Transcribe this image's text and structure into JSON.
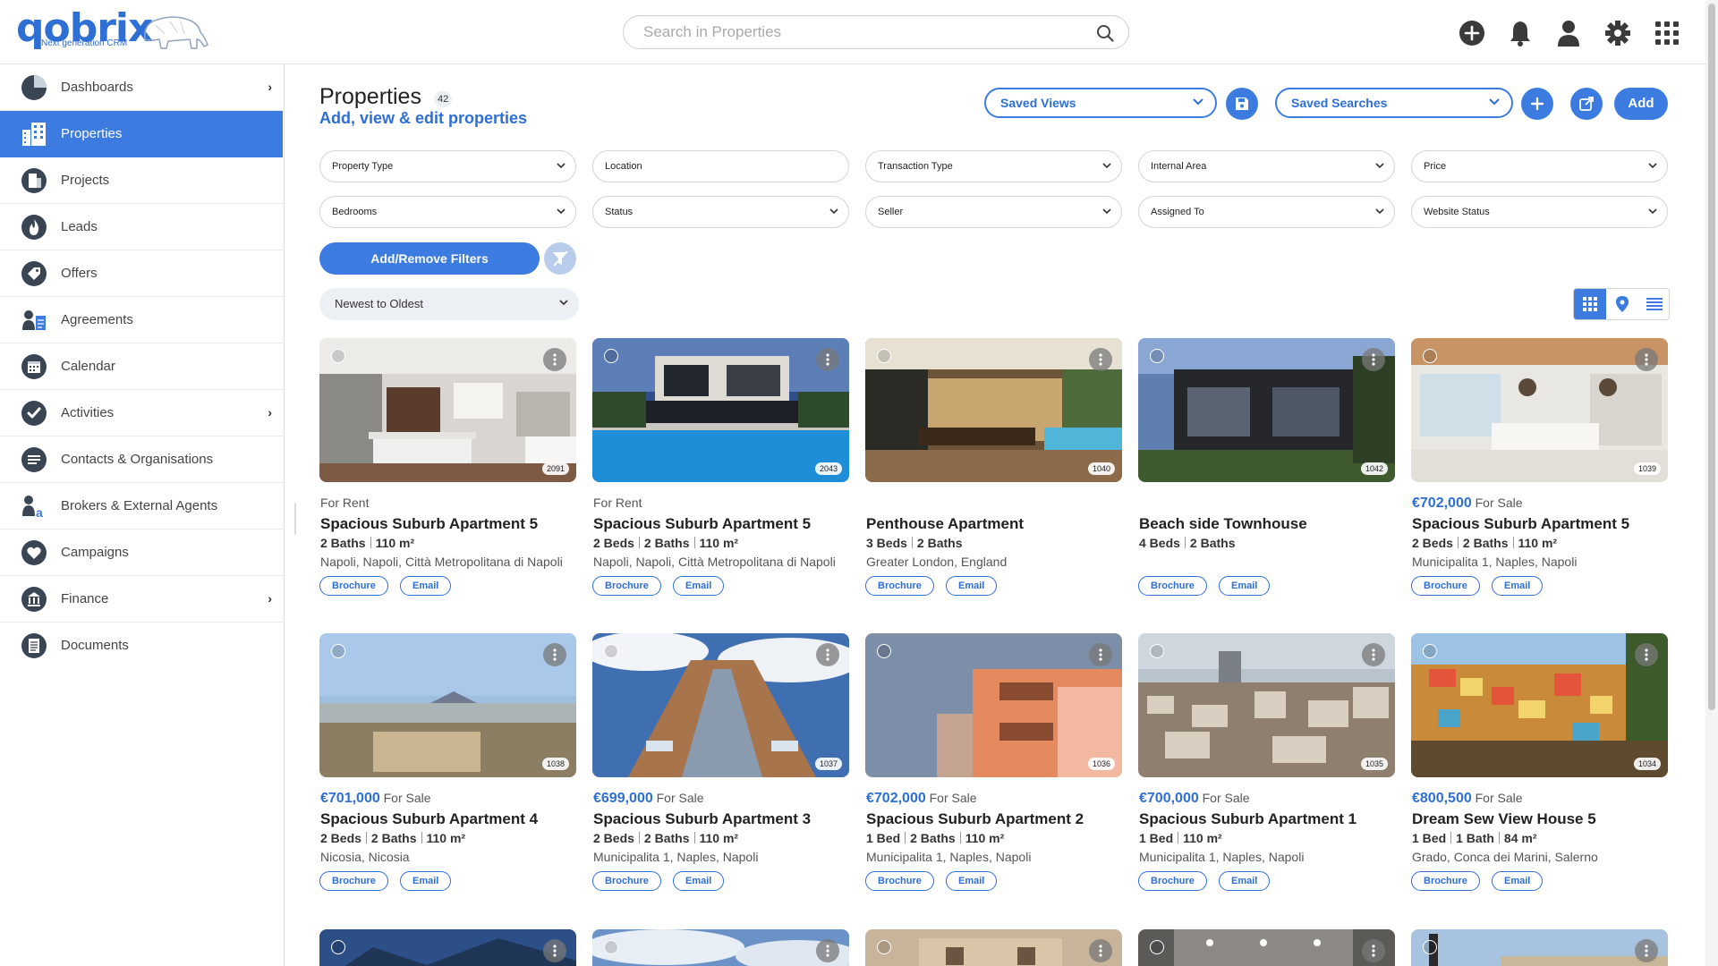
{
  "brand": {
    "name": "qobrix",
    "tagline": "Next generation CRM"
  },
  "search": {
    "placeholder": "Search in Properties",
    "value": ""
  },
  "top_icons": [
    "add-icon",
    "bell-icon",
    "user-icon",
    "gear-icon",
    "apps-grid-icon"
  ],
  "sidebar": {
    "items": [
      {
        "label": "Dashboards",
        "icon": "dashboard-icon",
        "has_submenu": true,
        "active": false
      },
      {
        "label": "Properties",
        "icon": "building-icon",
        "has_submenu": false,
        "active": true
      },
      {
        "label": "Projects",
        "icon": "projects-icon",
        "has_submenu": false,
        "active": false
      },
      {
        "label": "Leads",
        "icon": "fire-icon",
        "has_submenu": false,
        "active": false
      },
      {
        "label": "Offers",
        "icon": "tag-icon",
        "has_submenu": false,
        "active": false
      },
      {
        "label": "Agreements",
        "icon": "agreements-icon",
        "has_submenu": false,
        "active": false
      },
      {
        "label": "Calendar",
        "icon": "calendar-icon",
        "has_submenu": false,
        "active": false
      },
      {
        "label": "Activities",
        "icon": "check-circle-icon",
        "has_submenu": true,
        "active": false
      },
      {
        "label": "Contacts & Organisations",
        "icon": "contacts-icon",
        "has_submenu": false,
        "active": false
      },
      {
        "label": "Brokers & External Agents",
        "icon": "brokers-icon",
        "has_submenu": false,
        "active": false
      },
      {
        "label": "Campaigns",
        "icon": "heart-icon",
        "has_submenu": false,
        "active": false
      },
      {
        "label": "Finance",
        "icon": "finance-icon",
        "has_submenu": true,
        "active": false
      },
      {
        "label": "Documents",
        "icon": "documents-icon",
        "has_submenu": false,
        "active": false
      }
    ]
  },
  "header": {
    "title": "Properties",
    "count": "42",
    "subtitle": "Add, view & edit properties",
    "saved_views_label": "Saved Views",
    "saved_searches_label": "Saved Searches",
    "add_label": "Add"
  },
  "filters": {
    "row1": [
      "Property Type",
      "Location",
      "Transaction Type",
      "Internal Area",
      "Price"
    ],
    "row2": [
      "Bedrooms",
      "Status",
      "Seller",
      "Assigned To",
      "Website Status"
    ],
    "add_remove_label": "Add/Remove Filters"
  },
  "sort": {
    "selected": "Newest to Oldest"
  },
  "view_modes": {
    "options": [
      "grid-view-icon",
      "map-view-icon",
      "list-view-icon"
    ],
    "selected": "grid-view-icon"
  },
  "accent_color": "#3c7be0",
  "cards": [
    {
      "price": "",
      "transaction": "For Rent",
      "title": "Spacious Suburb Apartment 5",
      "specs": [
        "2 Baths",
        "110 m²"
      ],
      "location": "Napoli, Napoli, Città Metropolitana di Napoli",
      "ref": "2091",
      "actions": [
        "Brochure",
        "Email"
      ]
    },
    {
      "price": "",
      "transaction": "For Rent",
      "title": "Spacious Suburb Apartment 5",
      "specs": [
        "2 Beds",
        "2 Baths",
        "110 m²"
      ],
      "location": "Napoli, Napoli, Città Metropolitana di Napoli",
      "ref": "2043",
      "actions": [
        "Brochure",
        "Email"
      ]
    },
    {
      "price": "",
      "transaction": "",
      "title": "Penthouse Apartment",
      "specs": [
        "3 Beds",
        "2 Baths"
      ],
      "location": "Greater London, England",
      "ref": "1040",
      "actions": [
        "Brochure",
        "Email"
      ]
    },
    {
      "price": "",
      "transaction": "",
      "title": "Beach side Townhouse",
      "specs": [
        "4 Beds",
        "2 Baths"
      ],
      "location": "",
      "ref": "1042",
      "actions": [
        "Brochure",
        "Email"
      ]
    },
    {
      "price": "€702,000",
      "transaction": "For Sale",
      "title": "Spacious Suburb Apartment 5",
      "specs": [
        "2 Beds",
        "2 Baths",
        "110 m²"
      ],
      "location": "Municipalita 1, Naples, Napoli",
      "ref": "1039",
      "actions": [
        "Brochure",
        "Email"
      ]
    },
    {
      "price": "€701,000",
      "transaction": "For Sale",
      "title": "Spacious Suburb Apartment 4",
      "specs": [
        "2 Beds",
        "2 Baths",
        "110 m²"
      ],
      "location": "Nicosia, Nicosia",
      "ref": "1038",
      "actions": [
        "Brochure",
        "Email"
      ]
    },
    {
      "price": "€699,000",
      "transaction": "For Sale",
      "title": "Spacious Suburb Apartment 3",
      "specs": [
        "2 Beds",
        "2 Baths",
        "110 m²"
      ],
      "location": "Municipalita 1, Naples, Napoli",
      "ref": "1037",
      "actions": [
        "Brochure",
        "Email"
      ]
    },
    {
      "price": "€702,000",
      "transaction": "For Sale",
      "title": "Spacious Suburb Apartment 2",
      "specs": [
        "1 Bed",
        "2 Baths",
        "110 m²"
      ],
      "location": "Municipalita 1, Naples, Napoli",
      "ref": "1036",
      "actions": [
        "Brochure",
        "Email"
      ]
    },
    {
      "price": "€700,000",
      "transaction": "For Sale",
      "title": "Spacious Suburb Apartment 1",
      "specs": [
        "1 Bed",
        "110 m²"
      ],
      "location": "Municipalita 1, Naples, Napoli",
      "ref": "1035",
      "actions": [
        "Brochure",
        "Email"
      ]
    },
    {
      "price": "€800,500",
      "transaction": "For Sale",
      "title": "Dream Sew View House 5",
      "specs": [
        "1 Bed",
        "1 Bath",
        "84 m²"
      ],
      "location": "Grado, Conca dei Marini, Salerno",
      "ref": "1034",
      "actions": [
        "Brochure",
        "Email"
      ]
    }
  ]
}
